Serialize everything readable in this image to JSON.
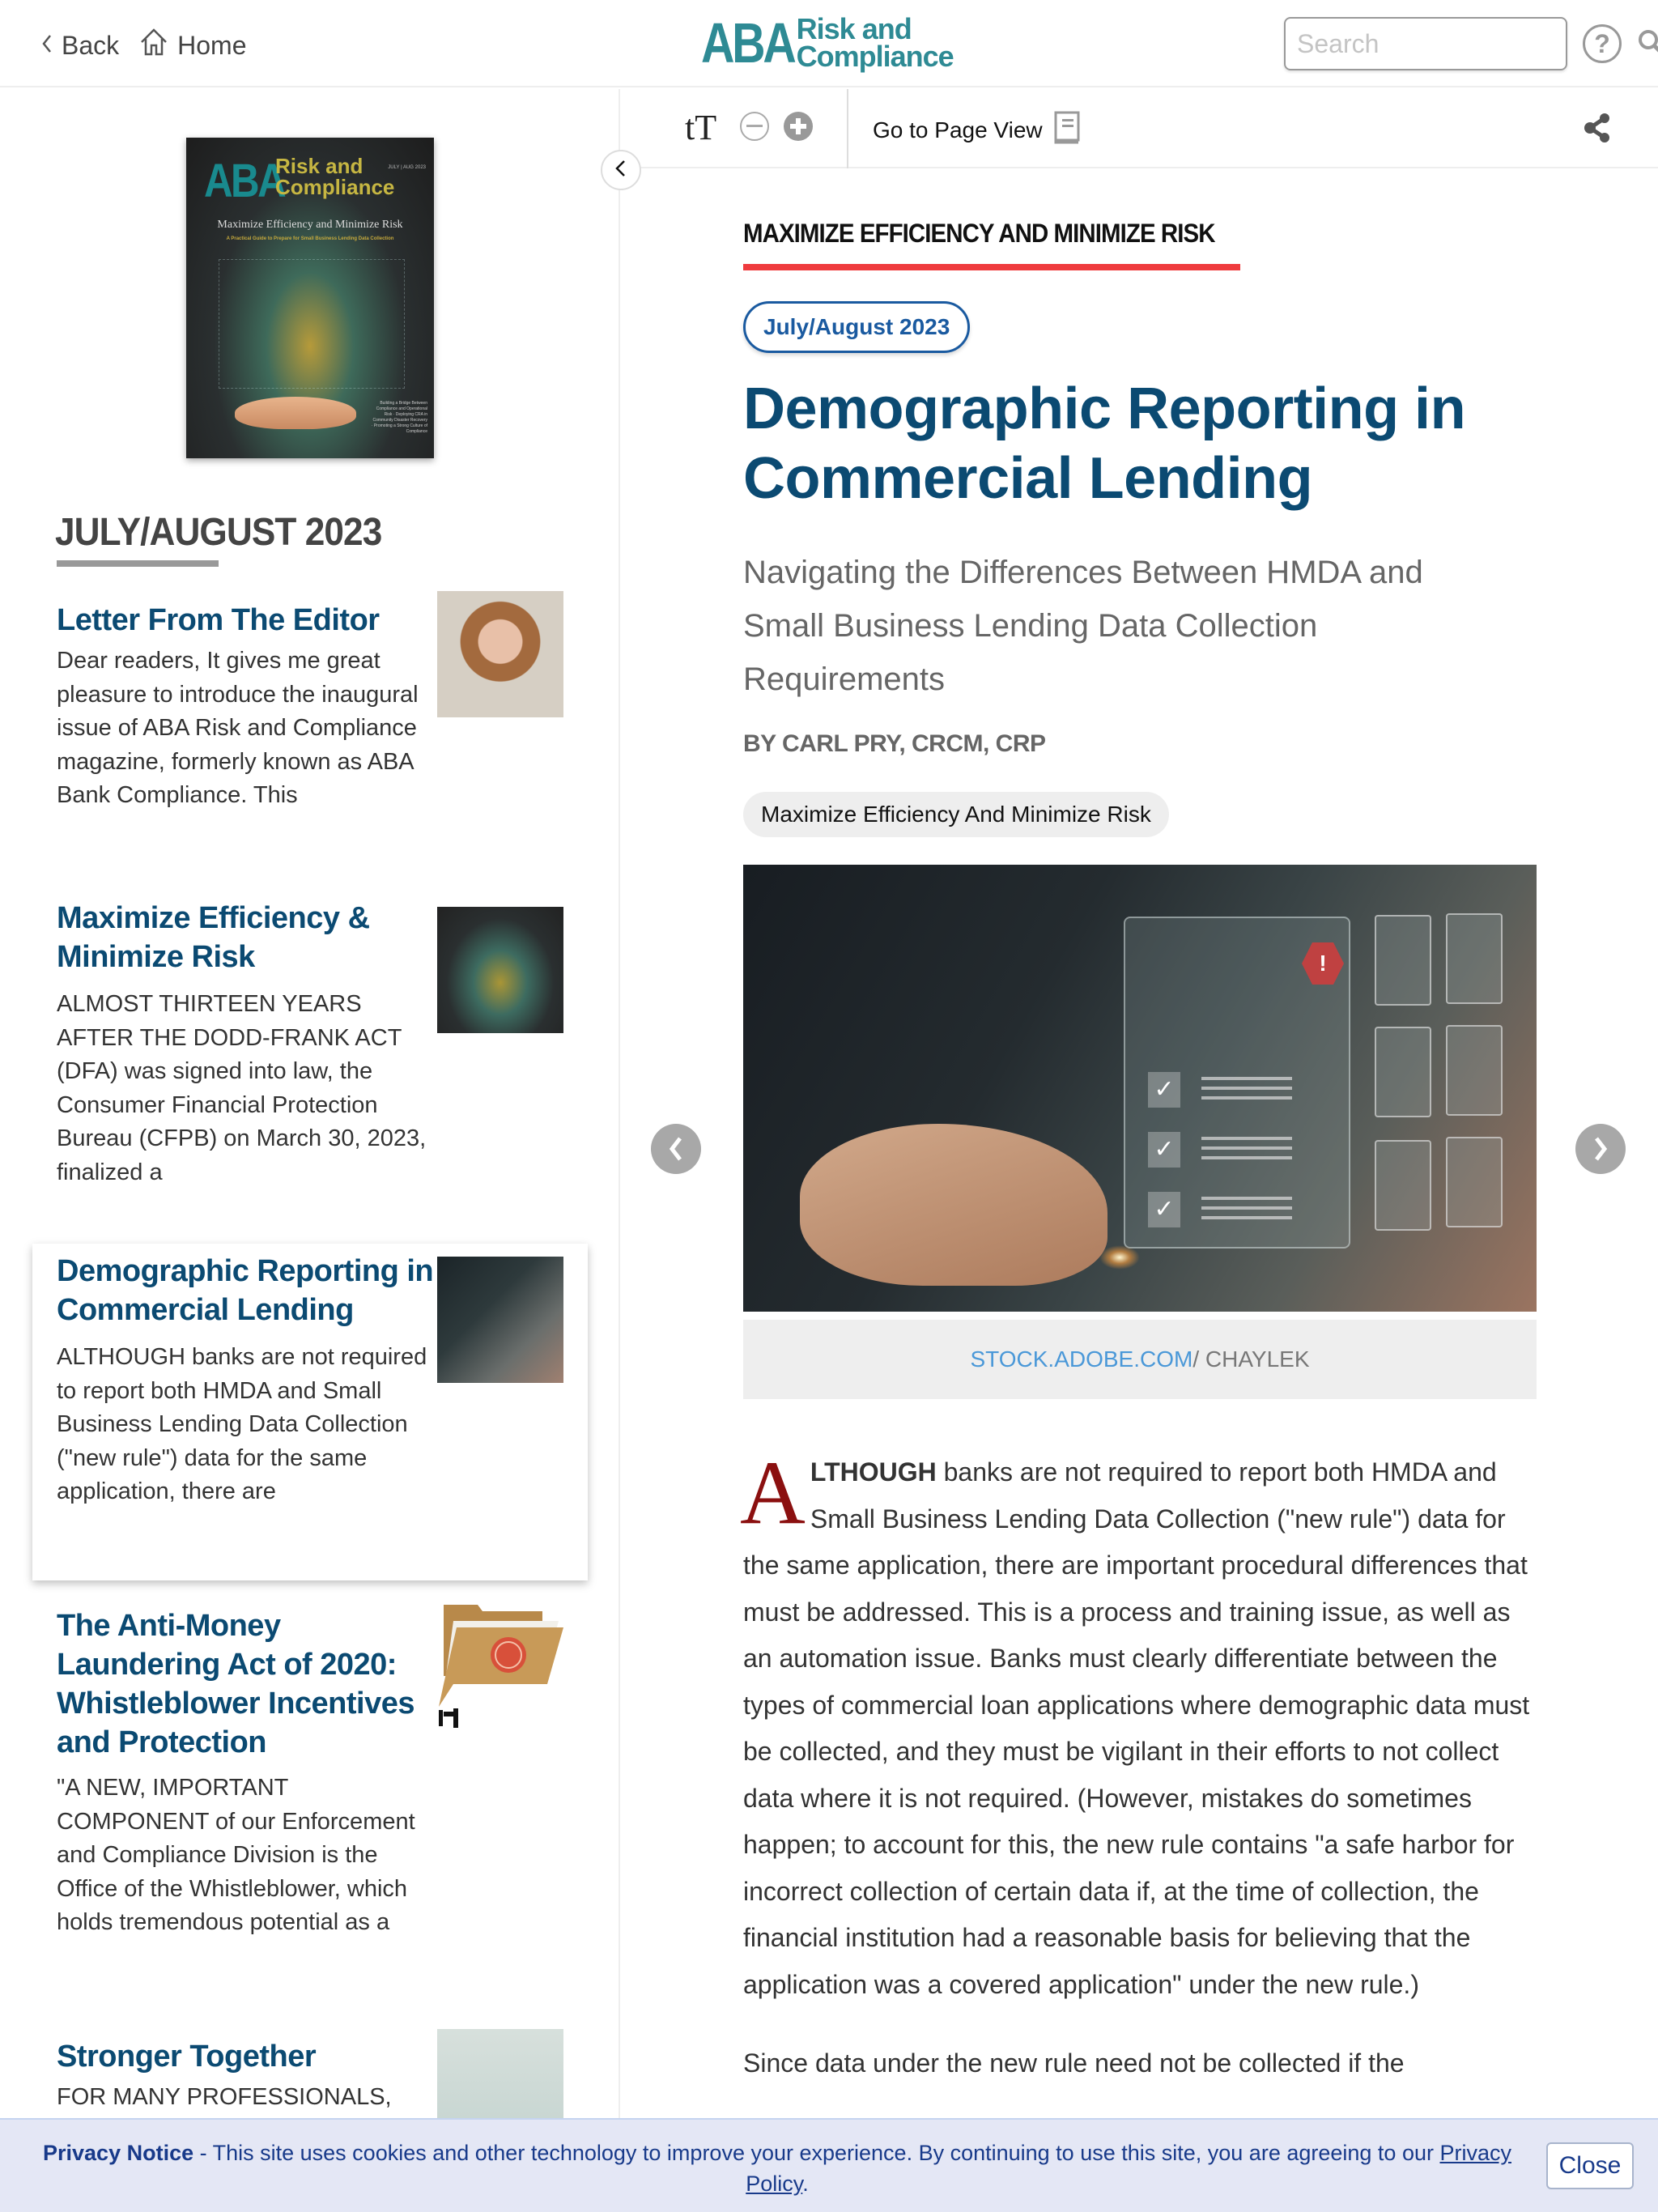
{
  "header": {
    "back_label": "Back",
    "home_label": "Home",
    "logo": {
      "aba": "ABA",
      "line1": "Risk and",
      "line2": "Compliance"
    },
    "search_placeholder": "Search",
    "help_icon": "?"
  },
  "toolbar": {
    "text_size_label": "tT",
    "page_view_label": "Go to Page View"
  },
  "sidebar": {
    "cover": {
      "aba": "ABA",
      "rc_line1": "Risk and",
      "rc_line2": "Compliance",
      "date": "JULY | AUG 2023",
      "title": "Maximize Efficiency and Minimize Risk",
      "subtitle": "A Practical Guide to Prepare for Small Business Lending Data Collection",
      "sidebar_text": "Building a Bridge Between Compliance and Operational Risk · Deploying CRA in Community Disaster Recovery · Promoting a Strong Culture of Compliance"
    },
    "issue_title": "JULY/AUGUST 2023",
    "items": [
      {
        "title": "Letter From The Editor",
        "excerpt": "Dear readers, It gives me great pleasure to introduce the inaugural issue of ABA Risk and Compliance magazine, formerly known as ABA Bank Compliance. This",
        "thumb": "editor-portrait"
      },
      {
        "title": "Maximize Efficiency & Minimize Risk",
        "excerpt": "ALMOST THIRTEEN YEARS AFTER THE DODD-FRANK ACT (DFA) was signed into law, the Consumer Financial Protection Bureau (CFPB) on March 30, 2023, finalized a",
        "thumb": "cover-art"
      },
      {
        "title": "Demographic Reporting in Commercial Lending",
        "excerpt": "ALTHOUGH banks are not required to report both HMDA and Small Business Lending Data Collection (\"new rule\") data for the same application, there are",
        "thumb": "checklist-hand",
        "active": true
      },
      {
        "title": "The Anti-Money Laundering Act of 2020: Whistleblower Incentives and Protection",
        "excerpt": "\"A NEW, IMPORTANT COMPONENT of our Enforcement and Compliance Division is the Office of the Whistleblower, which holds tremendous potential as a",
        "thumb": "folder-whistleblower"
      },
      {
        "title": "Stronger Together",
        "excerpt": "FOR MANY PROFESSIONALS,",
        "thumb": "rope-bridge"
      }
    ]
  },
  "article": {
    "kicker": "MAXIMIZE EFFICIENCY AND MINIMIZE RISK",
    "issue_pill": "July/August 2023",
    "title": "Demographic Reporting in Commercial Lending",
    "subtitle": "Navigating the Differences Between HMDA and Small Business Lending Data Collection Requirements",
    "byline": "BY CARL PRY, CRCM, CRP",
    "tag": "Maximize Efficiency And Minimize Risk",
    "image_caption_source": "STOCK.ADOBE.COM",
    "image_caption_credit": "/ CHAYLEK",
    "dropcap": "A",
    "lead_bold": "LTHOUGH",
    "paragraph1": " banks are not required to report both HMDA and Small Business Lending Data Collection (\"new rule\") data for the same application, there are important procedural differences that must be addressed. This is a process and training issue, as well as an automation issue. Banks must clearly differentiate between the types of commercial loan applications where demographic data must be collected, and they must be vigilant in their efforts to not collect data where it is not required. (However, mistakes do sometimes happen; to account for this, the new rule contains \"a safe harbor for incorrect collection of certain data if, at the time of collection, the financial institution had a reasonable basis for believing that the application was a covered application\" under the new rule.)",
    "paragraph2": "Since data under the new rule need not be collected if the"
  },
  "privacy": {
    "label": "Privacy Notice",
    "text": " - This site uses cookies and other technology to improve your experience. By continuing to use this site, you are agreeing to our ",
    "link": "Privacy Policy",
    "end": ".",
    "close_label": "Close"
  }
}
